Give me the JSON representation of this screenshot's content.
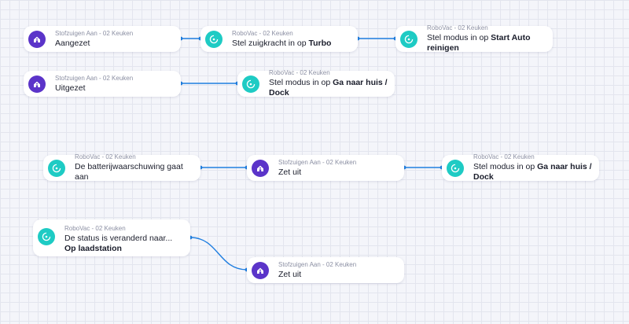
{
  "canvas": {
    "nodes": [
      {
        "id": "n1",
        "kind": "home-icon",
        "device": "Stofzuigen Aan - 02 Keuken",
        "text": "Aangezet",
        "value": ""
      },
      {
        "id": "n2",
        "kind": "vacuum-icon",
        "device": "RoboVac - 02 Keuken",
        "text": "Stel zuigkracht in op ",
        "value": "Turbo"
      },
      {
        "id": "n3",
        "kind": "vacuum-icon",
        "device": "RoboVac - 02 Keuken",
        "text": "Stel modus in op ",
        "value": "Start Auto reinigen"
      },
      {
        "id": "n4",
        "kind": "home-icon",
        "device": "Stofzuigen Aan - 02 Keuken",
        "text": "Uitgezet",
        "value": ""
      },
      {
        "id": "n5",
        "kind": "vacuum-icon",
        "device": "RoboVac - 02 Keuken",
        "text": "Stel modus in op ",
        "value": "Ga naar huis / Dock"
      },
      {
        "id": "n6",
        "kind": "vacuum-icon",
        "device": "RoboVac - 02 Keuken",
        "text": "De batterijwaarschuwing gaat aan",
        "value": ""
      },
      {
        "id": "n7",
        "kind": "home-icon",
        "device": "Stofzuigen Aan - 02 Keuken",
        "text": "Zet uit",
        "value": ""
      },
      {
        "id": "n8",
        "kind": "vacuum-icon",
        "device": "RoboVac - 02 Keuken",
        "text": "Stel modus in op ",
        "value": "Ga naar huis / Dock"
      },
      {
        "id": "n9",
        "kind": "vacuum-icon",
        "device": "RoboVac - 02 Keuken",
        "text": "De status is veranderd naar... ",
        "value": "Op laadstation"
      },
      {
        "id": "n10",
        "kind": "home-icon",
        "device": "Stofzuigen Aan - 02 Keuken",
        "text": "Zet uit",
        "value": ""
      }
    ],
    "links": [
      [
        "n1",
        "n2"
      ],
      [
        "n2",
        "n3"
      ],
      [
        "n4",
        "n5"
      ],
      [
        "n6",
        "n7"
      ],
      [
        "n7",
        "n8"
      ],
      [
        "n9",
        "n10"
      ]
    ],
    "colors": {
      "home_icon": "#5b34c9",
      "vacuum_icon": "#1ecbc4",
      "wire": "#1f7ee0"
    }
  }
}
